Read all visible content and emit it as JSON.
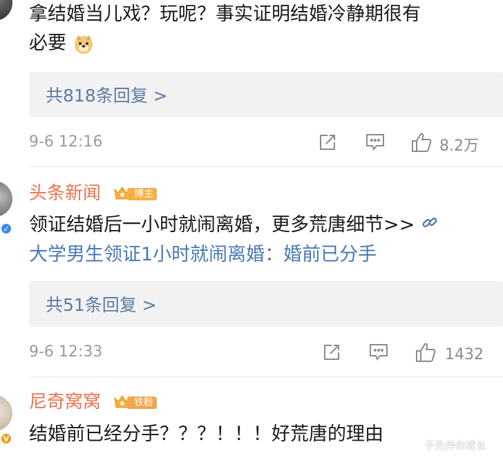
{
  "comment1": {
    "text_line1": "拿结婚当儿戏？玩呢？事实证明结婚冷静期很有",
    "text_line2": "必要",
    "emoji": "doge-emoji",
    "replies": "共818条回复 >",
    "time": "9-6 12:16",
    "likes": "8.2万"
  },
  "comment2": {
    "username": "头条新闻",
    "badge": "博主",
    "text_line1": "领证结婚后一小时就闹离婚，更多荒唐细节>>",
    "link_text": "大学男生领证1小时就闹离婚：婚前已分手",
    "replies": "共51条回复 >",
    "time": "9-6 12:33",
    "likes": "1432"
  },
  "comment3": {
    "username": "尼奇窝窝",
    "badge": "铁粉",
    "text_line1": "结婚前已经分手？？？！！！好荒唐的理由"
  },
  "watermark": "子先伴你成长",
  "colors": {
    "username": "#eb7350",
    "link": "#4a78b5",
    "reply_text": "#5b7ba4",
    "badge_gold": "#f5b042"
  }
}
